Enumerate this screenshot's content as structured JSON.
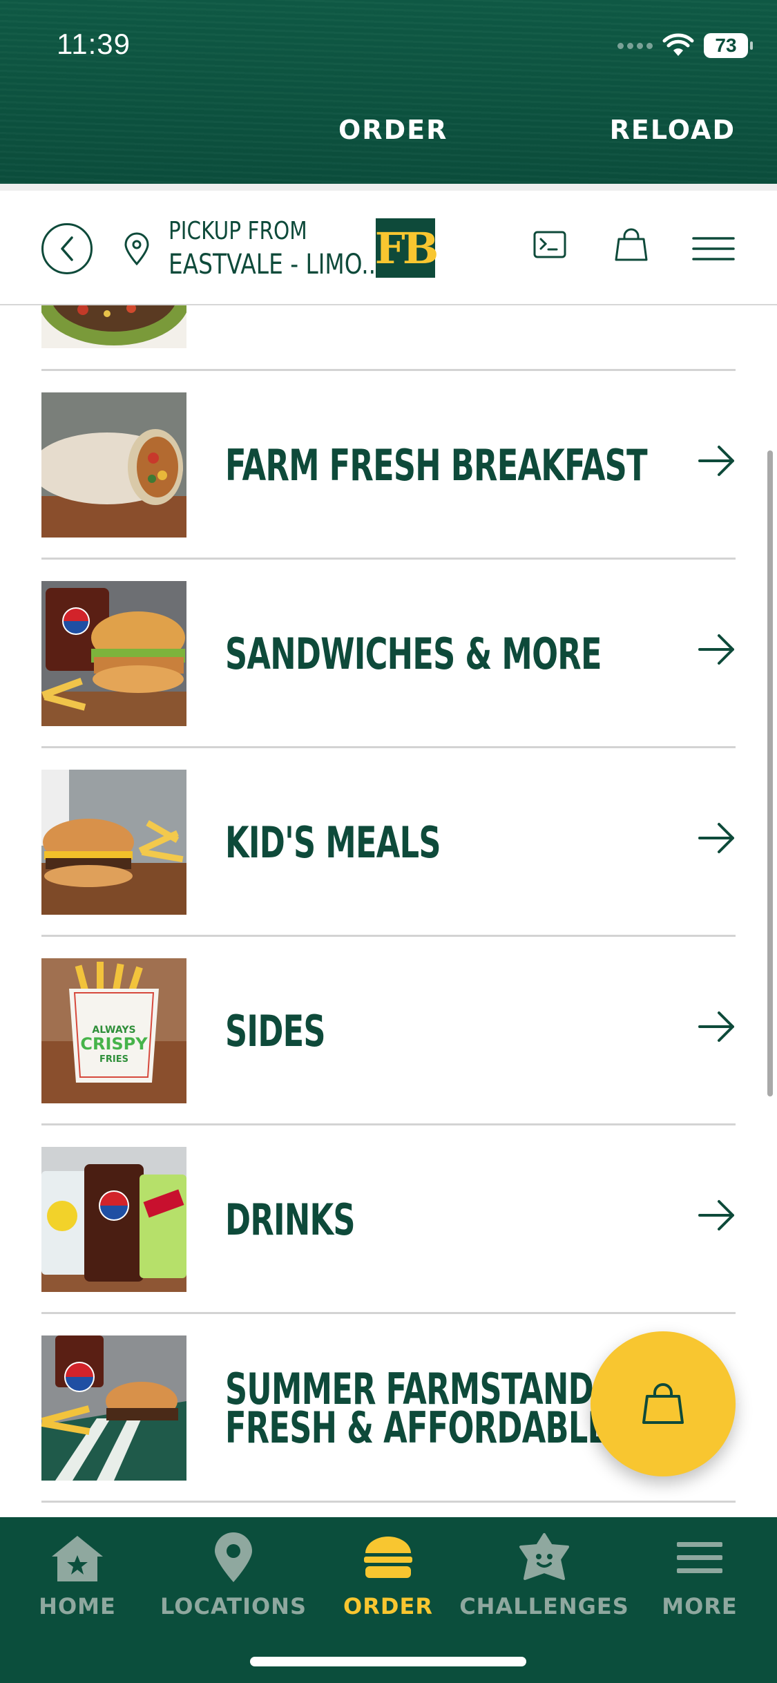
{
  "status_bar": {
    "time": "11:39",
    "battery": "73"
  },
  "header": {
    "order_label": "ORDER",
    "reload_label": "RELOAD"
  },
  "pickup": {
    "line1": "PICKUP FROM",
    "line2": "EASTVALE - LIMO...",
    "logo_text": "FB"
  },
  "menu": {
    "items": [
      {
        "label": "FARM FRESH BREAKFAST",
        "image": "breakfast-burrito"
      },
      {
        "label": "SANDWICHES & MORE",
        "image": "chicken-sandwich-combo"
      },
      {
        "label": "KID'S MEALS",
        "image": "kids-burger-fries"
      },
      {
        "label": "SIDES",
        "image": "crispy-fries"
      },
      {
        "label": "DRINKS",
        "image": "fountain-drinks"
      },
      {
        "label_line1": "SUMMER FARMSTAND",
        "label_line2": "FRESH & AFFORDABLE",
        "image": "burger-combo-box"
      }
    ],
    "fries_bag_text": {
      "line1": "ALWAYS",
      "line2": "CRISPY",
      "line3": "FRIES"
    }
  },
  "bottom_nav": {
    "items": [
      {
        "label": "HOME",
        "icon": "house-star-icon"
      },
      {
        "label": "LOCATIONS",
        "icon": "map-pin-icon"
      },
      {
        "label": "ORDER",
        "icon": "burger-icon",
        "active": true
      },
      {
        "label": "CHALLENGES",
        "icon": "star-face-icon"
      },
      {
        "label": "MORE",
        "icon": "hamburger-menu-icon"
      }
    ]
  },
  "colors": {
    "brand_green": "#0b4e3c",
    "text_green": "#0e4a3a",
    "accent_yellow": "#f8c630",
    "nav_inactive": "#8fa89f"
  }
}
